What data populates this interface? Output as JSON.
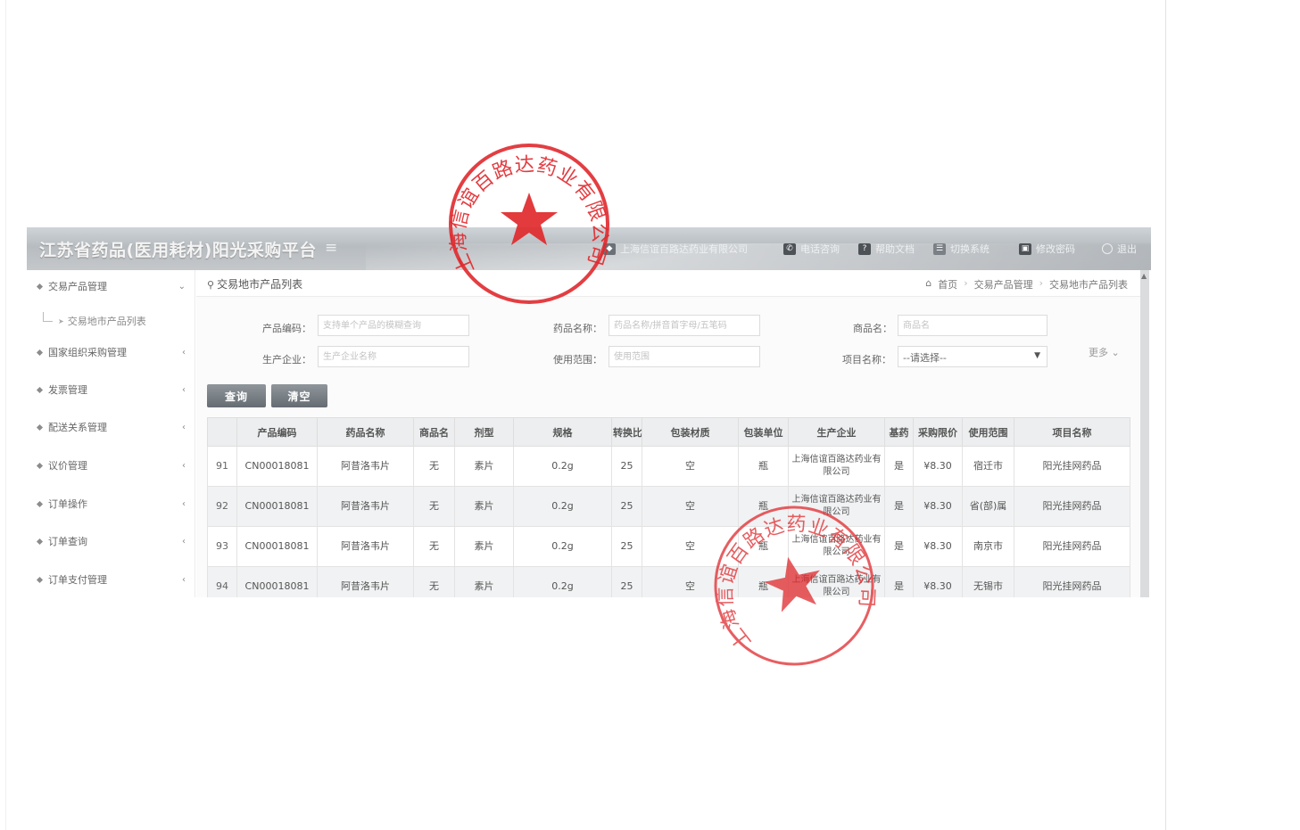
{
  "header": {
    "app_title": "江苏省药品(医用耗材)阳光采购平台",
    "company": "上海信谊百路达药业有限公司",
    "phone_consult": "电话咨询",
    "help_doc": "帮助文档",
    "switch_system": "切换系统",
    "change_password": "修改密码",
    "logout": "退出"
  },
  "sidebar": {
    "items": [
      {
        "label": "交易产品管理",
        "chevron": "⌄"
      },
      {
        "label": "国家组织采购管理",
        "chevron": "‹"
      },
      {
        "label": "发票管理",
        "chevron": "‹"
      },
      {
        "label": "配送关系管理",
        "chevron": "‹"
      },
      {
        "label": "议价管理",
        "chevron": "‹"
      },
      {
        "label": "订单操作",
        "chevron": "‹"
      },
      {
        "label": "订单查询",
        "chevron": "‹"
      },
      {
        "label": "订单支付管理",
        "chevron": "‹"
      }
    ],
    "sub_item": "交易地市产品列表"
  },
  "breadcrumb": {
    "page_title": "交易地市产品列表",
    "home": "首页",
    "level2": "交易产品管理",
    "level3": "交易地市产品列表"
  },
  "form": {
    "product_code_label": "产品编码：",
    "product_code_placeholder": "支持单个产品的模糊查询",
    "drug_name_label": "药品名称：",
    "drug_name_placeholder": "药品名称/拼音首字母/五笔码",
    "trade_name_label": "商品名：",
    "trade_name_placeholder": "商品名",
    "manufacturer_label": "生产企业：",
    "manufacturer_placeholder": "生产企业名称",
    "usage_scope_label": "使用范围：",
    "usage_scope_placeholder": "使用范围",
    "project_label": "项目名称：",
    "project_value": "--请选择--",
    "more": "更多 ⌄"
  },
  "buttons": {
    "query": "查询",
    "clear": "清空"
  },
  "table": {
    "headers": [
      "",
      "产品编码",
      "药品名称",
      "商品名",
      "剂型",
      "规格",
      "转换比",
      "包装材质",
      "包装单位",
      "生产企业",
      "基药",
      "采购限价",
      "使用范围",
      "项目名称"
    ],
    "rows": [
      [
        "91",
        "CN00018081",
        "阿昔洛韦片",
        "无",
        "素片",
        "0.2g",
        "25",
        "空",
        "瓶",
        "上海信谊百路达药业有限公司",
        "是",
        "¥8.30",
        "宿迁市",
        "阳光挂网药品"
      ],
      [
        "92",
        "CN00018081",
        "阿昔洛韦片",
        "无",
        "素片",
        "0.2g",
        "25",
        "空",
        "瓶",
        "上海信谊百路达药业有限公司",
        "是",
        "¥8.30",
        "省(部)属",
        "阳光挂网药品"
      ],
      [
        "93",
        "CN00018081",
        "阿昔洛韦片",
        "无",
        "素片",
        "0.2g",
        "25",
        "空",
        "瓶",
        "上海信谊百路达药业有限公司",
        "是",
        "¥8.30",
        "南京市",
        "阳光挂网药品"
      ],
      [
        "94",
        "CN00018081",
        "阿昔洛韦片",
        "无",
        "素片",
        "0.2g",
        "25",
        "空",
        "瓶",
        "上海信谊百路达药业有限公司",
        "是",
        "¥8.30",
        "无锡市",
        "阳光挂网药品"
      ]
    ]
  },
  "stamps": {
    "seal_text": "上海信谊百路达药业有限公司",
    "color": "#e0292d"
  },
  "colors": {
    "header_bg": "#c1c6ca",
    "button_bg": "#727a80",
    "table_header_bg": "#eceeef"
  }
}
